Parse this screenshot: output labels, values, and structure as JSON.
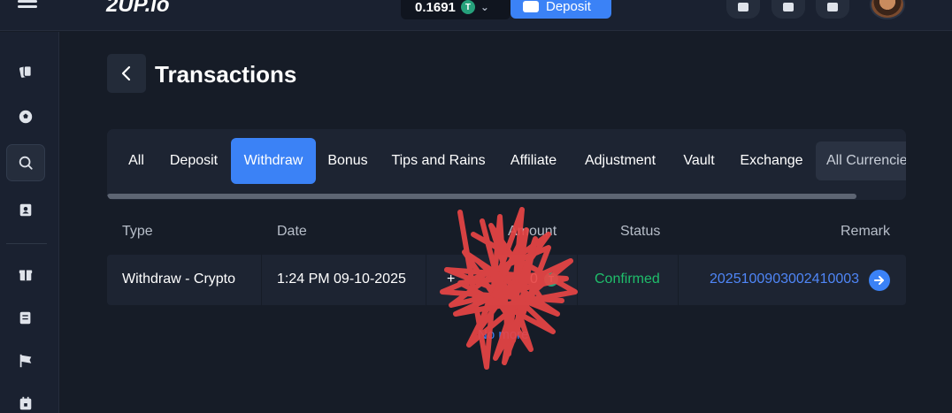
{
  "header": {
    "logo": "2UP.io",
    "balance": "0.1691",
    "balance_currency_symbol": "T",
    "deposit_label": "Deposit"
  },
  "page": {
    "title": "Transactions"
  },
  "tabs": [
    {
      "label": "All",
      "active": false
    },
    {
      "label": "Deposit",
      "active": false
    },
    {
      "label": "Withdraw",
      "active": true
    },
    {
      "label": "Bonus",
      "active": false
    },
    {
      "label": "Tips and Rains",
      "active": false
    },
    {
      "label": "Affiliate",
      "active": false
    },
    {
      "label": "Adjustment",
      "active": false
    },
    {
      "label": "Vault",
      "active": false
    },
    {
      "label": "Exchange",
      "active": false
    }
  ],
  "currency_filter": "All Currencies",
  "table": {
    "columns": [
      "Type",
      "Date",
      "Amount",
      "Status",
      "Remark"
    ],
    "rows": [
      {
        "type": "Withdraw - Crypto",
        "date": "1:24 PM 09-10-2025",
        "amount_visible_fragment_start": "+",
        "amount_visible_fragment_end": "0",
        "amount_currency_symbol": "T",
        "status": "Confirmed",
        "remark": "2025100903002410003"
      }
    ],
    "load_more": "No more"
  },
  "colors": {
    "accent": "#3b82f6",
    "status_confirmed": "#1fbe6b",
    "usdt": "#26a17b",
    "redaction": "#e84545"
  },
  "icons": {
    "sidebar": [
      "cards-icon",
      "soccer-ball-icon",
      "search-icon",
      "contacts-icon",
      "gift-icon",
      "news-icon",
      "flag-icon",
      "calendar-icon"
    ]
  }
}
